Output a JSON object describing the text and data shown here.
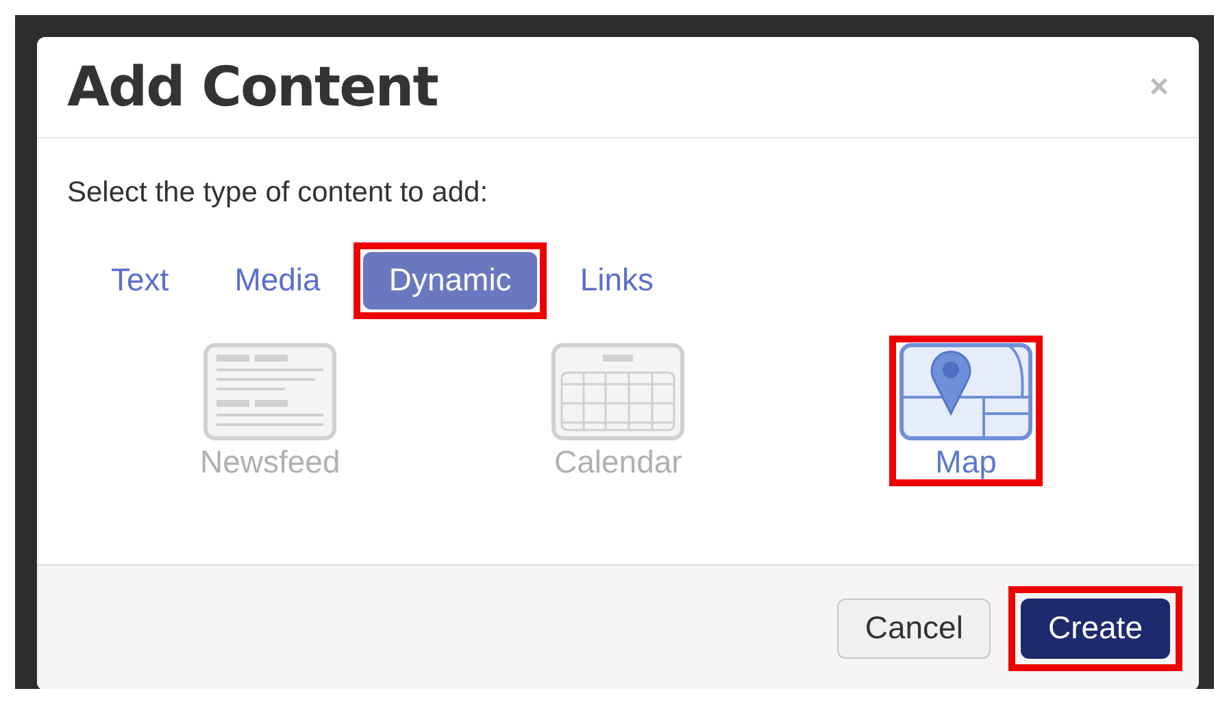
{
  "dialog": {
    "title": "Add Content",
    "close": "×",
    "prompt": "Select the type of content to add:",
    "tabs": [
      {
        "label": "Text",
        "selected": false,
        "highlighted": false
      },
      {
        "label": "Media",
        "selected": false,
        "highlighted": false
      },
      {
        "label": "Dynamic",
        "selected": true,
        "highlighted": true
      },
      {
        "label": "Links",
        "selected": false,
        "highlighted": false
      }
    ],
    "items": [
      {
        "kind": "newsfeed",
        "label": "Newsfeed",
        "disabled": true,
        "highlighted": false
      },
      {
        "kind": "calendar",
        "label": "Calendar",
        "disabled": true,
        "highlighted": false
      },
      {
        "kind": "map",
        "label": "Map",
        "disabled": false,
        "highlighted": true
      }
    ],
    "buttons": [
      {
        "kind": "default",
        "label": "Cancel",
        "highlighted": false
      },
      {
        "kind": "primary",
        "label": "Create",
        "highlighted": true
      }
    ]
  }
}
